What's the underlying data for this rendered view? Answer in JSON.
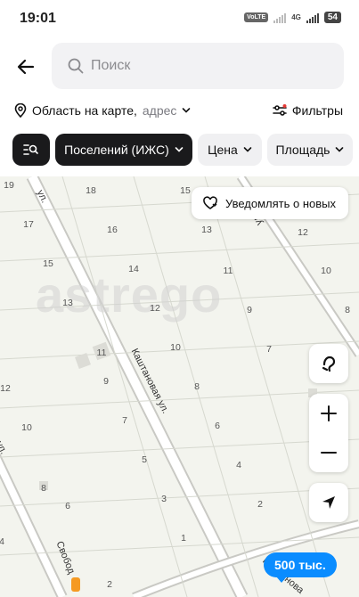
{
  "status_bar": {
    "time": "19:01",
    "volte": "VoLTE",
    "network": "4G",
    "battery": "54"
  },
  "search": {
    "placeholder": "Поиск"
  },
  "area": {
    "label": "Область на карте,",
    "hint": "адрес"
  },
  "filters": {
    "label": "Фильтры"
  },
  "chips": [
    {
      "label": "Поселений (ИЖС)"
    },
    {
      "label": "Цена"
    },
    {
      "label": "Площадь"
    }
  ],
  "notify": {
    "label": "Уведомлять о новых"
  },
  "streets": {
    "main": "Каштановая ул.",
    "left": "ул.",
    "upper_right": "ул.",
    "bottom": "Свобод",
    "bottom_right": "Каштанова"
  },
  "price_pin": {
    "label": "500 тыс."
  },
  "watermark": "astrego",
  "parcels": [
    "19",
    "18",
    "15",
    "17",
    "16",
    "13",
    "12",
    "15",
    "14",
    "11",
    "10",
    "13",
    "12",
    "9",
    "8",
    "11",
    "10",
    "7",
    "12",
    "9",
    "8",
    "7",
    "6",
    "10",
    "5",
    "4",
    "8",
    "3",
    "2",
    "6",
    "1",
    "4",
    "2"
  ],
  "icons": {
    "back": "arrow-left-icon",
    "search": "search-icon",
    "location": "location-pin-icon",
    "filters": "sliders-icon",
    "notify": "heart-bell-icon",
    "layers": "hand-point-icon",
    "zoom_in": "plus-icon",
    "zoom_out": "minus-icon",
    "locate": "navigation-arrow-icon"
  },
  "colors": {
    "accent": "#0a8cff",
    "chip_dark": "#1a1a1c",
    "map_bg": "#f3f4ee"
  }
}
